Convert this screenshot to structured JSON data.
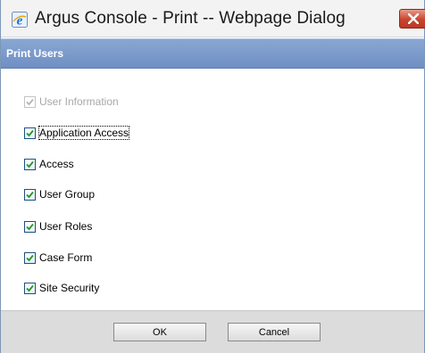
{
  "window": {
    "title": "Argus Console - Print -- Webpage Dialog",
    "icon": "internet-explorer-icon",
    "close_icon": "close-icon"
  },
  "header": {
    "title": "Print Users"
  },
  "checkboxes": [
    {
      "label": "User Information",
      "checked": true,
      "enabled": false
    },
    {
      "label": "Application Access",
      "checked": true,
      "enabled": true,
      "focused": true
    },
    {
      "label": "Access",
      "checked": true,
      "enabled": true
    },
    {
      "label": "User Group",
      "checked": true,
      "enabled": true
    },
    {
      "label": "User Roles",
      "checked": true,
      "enabled": true
    },
    {
      "label": "Case Form",
      "checked": true,
      "enabled": true
    },
    {
      "label": "Site Security",
      "checked": true,
      "enabled": true
    }
  ],
  "buttons": {
    "ok": "OK",
    "cancel": "Cancel"
  },
  "colors": {
    "header_bg": "#7a98c9",
    "check_green": "#1f9a1f",
    "close_red": "#c8442f"
  }
}
